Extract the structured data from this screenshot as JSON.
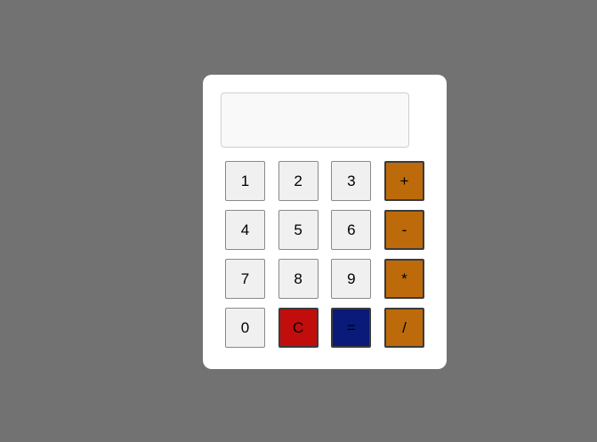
{
  "display": {
    "value": ""
  },
  "keys": [
    {
      "label": "1",
      "name": "key-1-button",
      "color": "#f0f0f0",
      "kind": "digit"
    },
    {
      "label": "2",
      "name": "key-2-button",
      "color": "#f0f0f0",
      "kind": "digit"
    },
    {
      "label": "3",
      "name": "key-3-button",
      "color": "#f0f0f0",
      "kind": "digit"
    },
    {
      "label": "+",
      "name": "add-button",
      "color": "#bd6a0a",
      "kind": "op"
    },
    {
      "label": "4",
      "name": "key-4-button",
      "color": "#f0f0f0",
      "kind": "digit"
    },
    {
      "label": "5",
      "name": "key-5-button",
      "color": "#f0f0f0",
      "kind": "digit"
    },
    {
      "label": "6",
      "name": "key-6-button",
      "color": "#f0f0f0",
      "kind": "digit"
    },
    {
      "label": "-",
      "name": "subtract-button",
      "color": "#bd6a0a",
      "kind": "op"
    },
    {
      "label": "7",
      "name": "key-7-button",
      "color": "#f0f0f0",
      "kind": "digit"
    },
    {
      "label": "8",
      "name": "key-8-button",
      "color": "#f0f0f0",
      "kind": "digit"
    },
    {
      "label": "9",
      "name": "key-9-button",
      "color": "#f0f0f0",
      "kind": "digit"
    },
    {
      "label": "*",
      "name": "multiply-button",
      "color": "#bd6a0a",
      "kind": "op"
    },
    {
      "label": "0",
      "name": "key-0-button",
      "color": "#f0f0f0",
      "kind": "digit"
    },
    {
      "label": "C",
      "name": "clear-button",
      "color": "#c20d0d",
      "kind": "op"
    },
    {
      "label": "=",
      "name": "equals-button",
      "color": "#0a1a78",
      "kind": "op"
    },
    {
      "label": "/",
      "name": "divide-button",
      "color": "#bd6a0a",
      "kind": "op"
    }
  ]
}
